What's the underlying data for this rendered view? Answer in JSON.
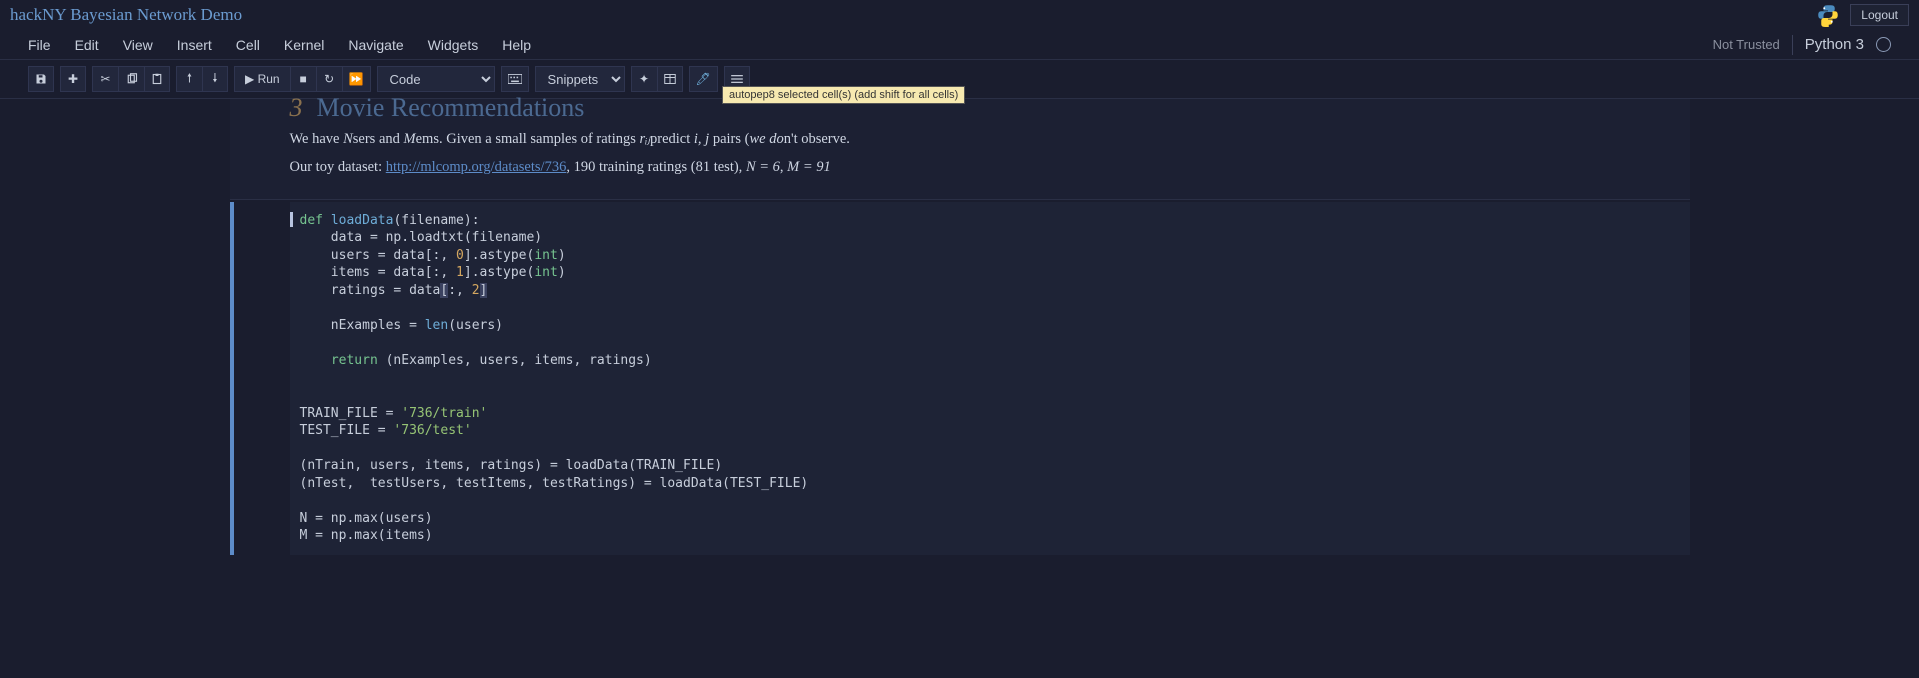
{
  "header": {
    "title": "hackNY Bayesian Network Demo",
    "logout": "Logout"
  },
  "menu": {
    "file": "File",
    "edit": "Edit",
    "view": "View",
    "insert": "Insert",
    "cell": "Cell",
    "kernel": "Kernel",
    "navigate": "Navigate",
    "widgets": "Widgets",
    "help": "Help",
    "trust": "Not Trusted",
    "kernel_name": "Python 3"
  },
  "toolbar": {
    "run": "Run",
    "celltype": "Code",
    "snippets": "Snippets",
    "tooltip": "autopep8 selected cell(s) (add shift for all cells)"
  },
  "markdown": {
    "section_num": "3",
    "section_title": "Movie Recommendations",
    "p1_a": "We have ",
    "p1_b": "sers and ",
    "p1_c": "ems. Given a small samples of ratings ",
    "p1_d": "predict ",
    "p1_e": " pairs (",
    "p1_f": "n't observe.",
    "N": "N",
    "M": "M",
    "rij": "rᵢⱼ",
    "ij": "i, j",
    "wedo": "we do",
    "p2_a": "Our toy dataset: ",
    "link": "http://mlcomp.org/datasets/736",
    "p2_b": ", 190 training ratings (81 test), ",
    "eqN": "N = 6",
    "eqM": "M = 91",
    "comma": ", "
  },
  "code": {
    "l1_def": "def ",
    "l1_fn": "loadData",
    "l1_rest": "(filename):",
    "l2": "    data = np.loadtxt(filename)",
    "l3_a": "    users = data[:, ",
    "l3_n": "0",
    "l3_b": "].astype(",
    "l3_t": "int",
    "l3_c": ")",
    "l4_a": "    items = data[:, ",
    "l4_n": "1",
    "l4_b": "].astype(",
    "l4_t": "int",
    "l4_c": ")",
    "l5_a": "    ratings = data",
    "l5_br1": "[",
    "l5_b": ":, ",
    "l5_n": "2",
    "l5_br2": "]",
    "l6_a": "    nExamples = ",
    "l6_fn": "len",
    "l6_b": "(users)",
    "l7_a": "    ",
    "l7_kw": "return",
    "l7_b": " (nExamples, users, items, ratings)",
    "l8_a": "TRAIN_FILE = ",
    "l8_s": "'736/train'",
    "l9_a": "TEST_FILE = ",
    "l9_s": "'736/test'",
    "l10": "(nTrain, users, items, ratings) = loadData(TRAIN_FILE)",
    "l11": "(nTest,  testUsers, testItems, testRatings) = loadData(TEST_FILE)",
    "l12": "N = np.max(users)",
    "l13": "M = np.max(items)"
  }
}
